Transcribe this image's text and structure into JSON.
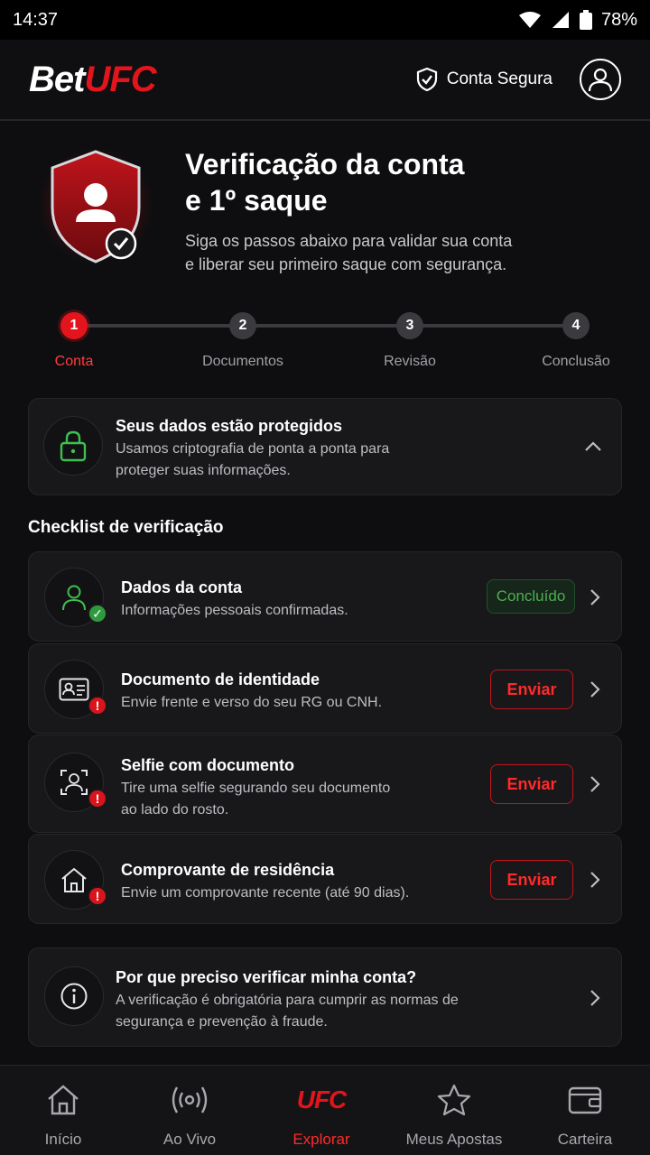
{
  "status_bar": {
    "time": "14:37",
    "battery": "78%"
  },
  "header": {
    "logo_bet": "Bet",
    "logo_ufc": "UFC",
    "secure_label": "Conta Segura"
  },
  "hero": {
    "title_line1": "Verificação da conta",
    "title_line2": "e 1º saque",
    "subtitle_line1": "Siga os passos abaixo para validar sua conta",
    "subtitle_line2": "e liberar seu primeiro saque com segurança."
  },
  "stepper": {
    "current_step": 1,
    "steps": [
      {
        "number": "1",
        "label": "Conta"
      },
      {
        "number": "2",
        "label": "Documentos"
      },
      {
        "number": "3",
        "label": "Revisão"
      },
      {
        "number": "4",
        "label": "Conclusão"
      }
    ]
  },
  "security_notice": {
    "title": "Seus dados estão protegidos",
    "text_line1": "Usamos criptografia de ponta a ponta para",
    "text_line2": "proteger suas informações."
  },
  "checklist": {
    "title": "Checklist de verificação",
    "items": [
      {
        "title": "Dados da conta",
        "text_line1": "Informações pessoais confirmadas.",
        "text_line2": "",
        "status": "Concluído"
      },
      {
        "title": "Documento de identidade",
        "text_line1": "Envie frente e verso do seu RG ou CNH.",
        "text_line2": "",
        "status": "Enviar"
      },
      {
        "title": "Selfie com documento",
        "text_line1": "Tire uma selfie segurando seu documento",
        "text_line2": "ao lado do rosto.",
        "status": "Enviar"
      },
      {
        "title": "Comprovante de residência",
        "text_line1": "Envie um comprovante recente (até 90 dias).",
        "text_line2": "",
        "status": "Enviar"
      }
    ]
  },
  "faq": {
    "title": "Por que preciso verificar minha conta?",
    "text_line1": "A verificação é obrigatória para cumprir as normas de",
    "text_line2": "segurança e prevenção à fraude."
  },
  "bottom_nav": {
    "items": [
      {
        "label": "Início",
        "icon": "home-icon"
      },
      {
        "label": "Ao Vivo",
        "icon": "live-icon"
      },
      {
        "label": "Explorar",
        "icon": "ufc-icon",
        "icon_text": "UFC"
      },
      {
        "label": "Meus Apostas",
        "icon": "star-icon"
      },
      {
        "label": "Carteira",
        "icon": "wallet-icon"
      }
    ],
    "active_index": 2
  },
  "colors": {
    "background": "#0e0e10",
    "accent_red": "#e3141c",
    "success_green": "#4caf50",
    "card": "#18181b"
  }
}
